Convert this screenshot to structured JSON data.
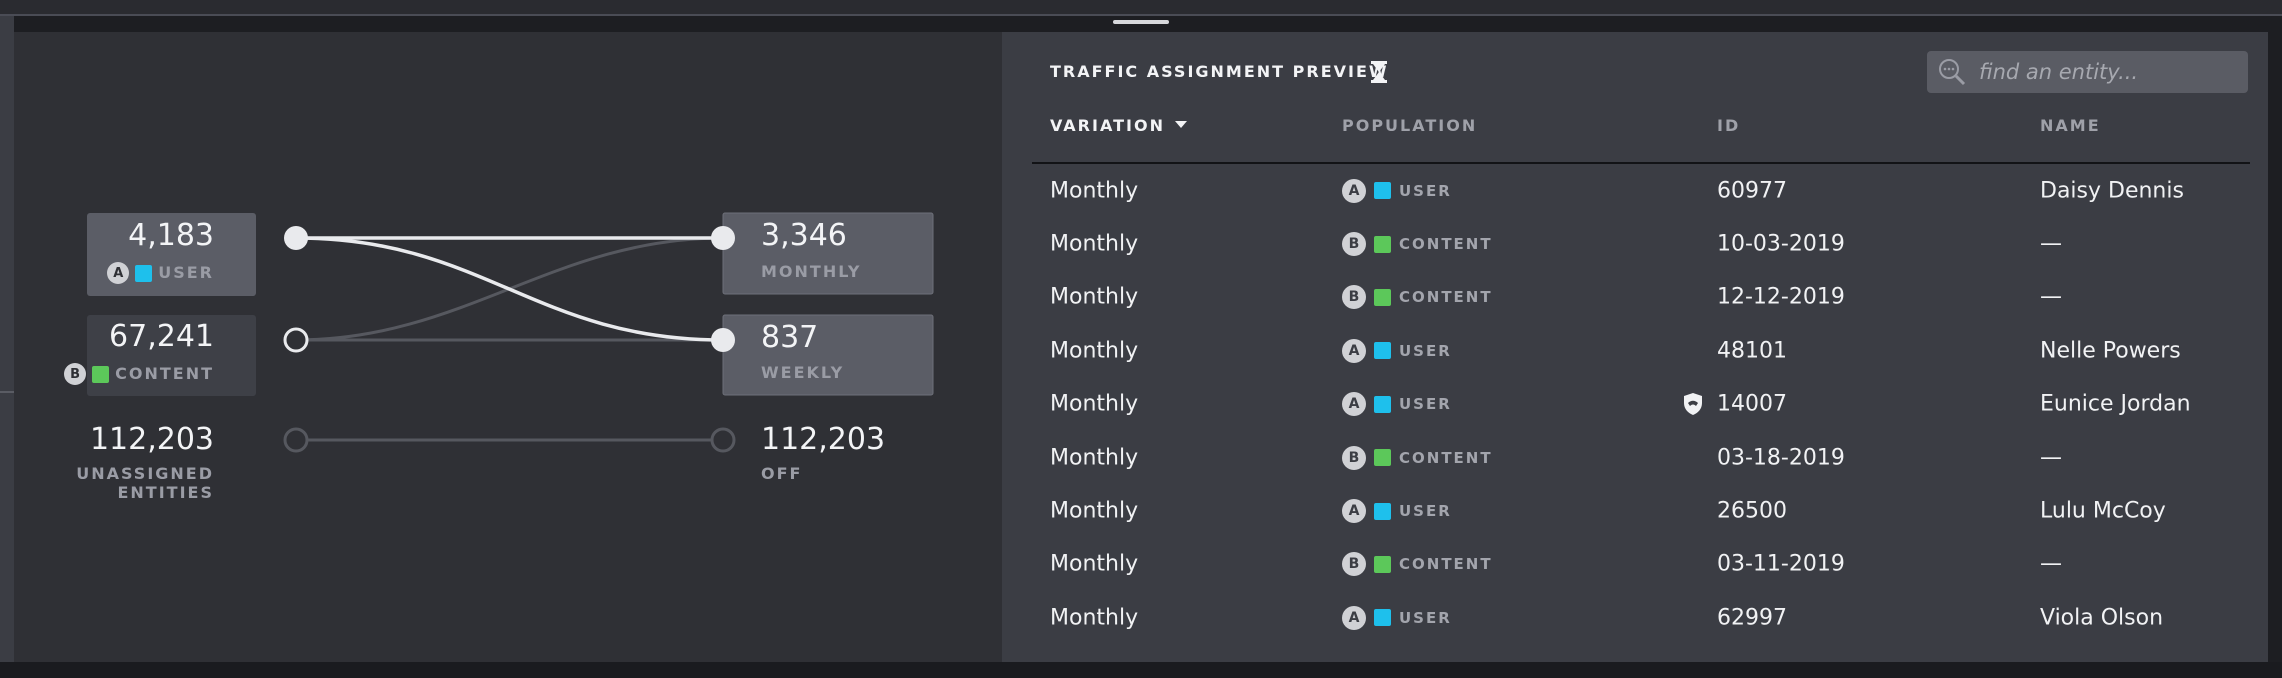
{
  "flow": {
    "sources": [
      {
        "value": "4,183",
        "badge": "A",
        "swatch_color": "#1ec0ec",
        "label": "USER"
      },
      {
        "value": "67,241",
        "badge": "B",
        "swatch_color": "#5cc85a",
        "label": "CONTENT"
      },
      {
        "value": "112,203",
        "label_line1": "UNASSIGNED",
        "label_line2": "ENTITIES"
      }
    ],
    "targets": [
      {
        "value": "3,346",
        "label": "MONTHLY"
      },
      {
        "value": "837",
        "label": "WEEKLY"
      },
      {
        "value": "112,203",
        "label": "OFF"
      }
    ]
  },
  "table": {
    "title": "TRAFFIC ASSIGNMENT PREVIEW",
    "title_icon": "hourglass-icon",
    "search": {
      "placeholder": "find an entity...",
      "value": "",
      "icon": "search-icon"
    },
    "columns": {
      "variation": "VARIATION",
      "population": "POPULATION",
      "id": "ID",
      "name": "NAME"
    },
    "sort_column": "variation",
    "rows": [
      {
        "variation": "Monthly",
        "badge": "A",
        "swatch_color": "#1ec0ec",
        "population": "USER",
        "id": "60977",
        "name": "Daisy Dennis"
      },
      {
        "variation": "Monthly",
        "badge": "B",
        "swatch_color": "#5cc85a",
        "population": "CONTENT",
        "id": "10-03-2019",
        "name": "—"
      },
      {
        "variation": "Monthly",
        "badge": "B",
        "swatch_color": "#5cc85a",
        "population": "CONTENT",
        "id": "12-12-2019",
        "name": "—"
      },
      {
        "variation": "Monthly",
        "badge": "A",
        "swatch_color": "#1ec0ec",
        "population": "USER",
        "id": "48101",
        "name": "Nelle Powers"
      },
      {
        "variation": "Monthly",
        "badge": "A",
        "swatch_color": "#1ec0ec",
        "population": "USER",
        "id": "14007",
        "name": "Eunice Jordan",
        "shield": true
      },
      {
        "variation": "Monthly",
        "badge": "B",
        "swatch_color": "#5cc85a",
        "population": "CONTENT",
        "id": "03-18-2019",
        "name": "—"
      },
      {
        "variation": "Monthly",
        "badge": "A",
        "swatch_color": "#1ec0ec",
        "population": "USER",
        "id": "26500",
        "name": "Lulu McCoy"
      },
      {
        "variation": "Monthly",
        "badge": "B",
        "swatch_color": "#5cc85a",
        "population": "CONTENT",
        "id": "03-11-2019",
        "name": "—"
      },
      {
        "variation": "Monthly",
        "badge": "A",
        "swatch_color": "#1ec0ec",
        "population": "USER",
        "id": "62997",
        "name": "Viola Olson"
      }
    ]
  }
}
